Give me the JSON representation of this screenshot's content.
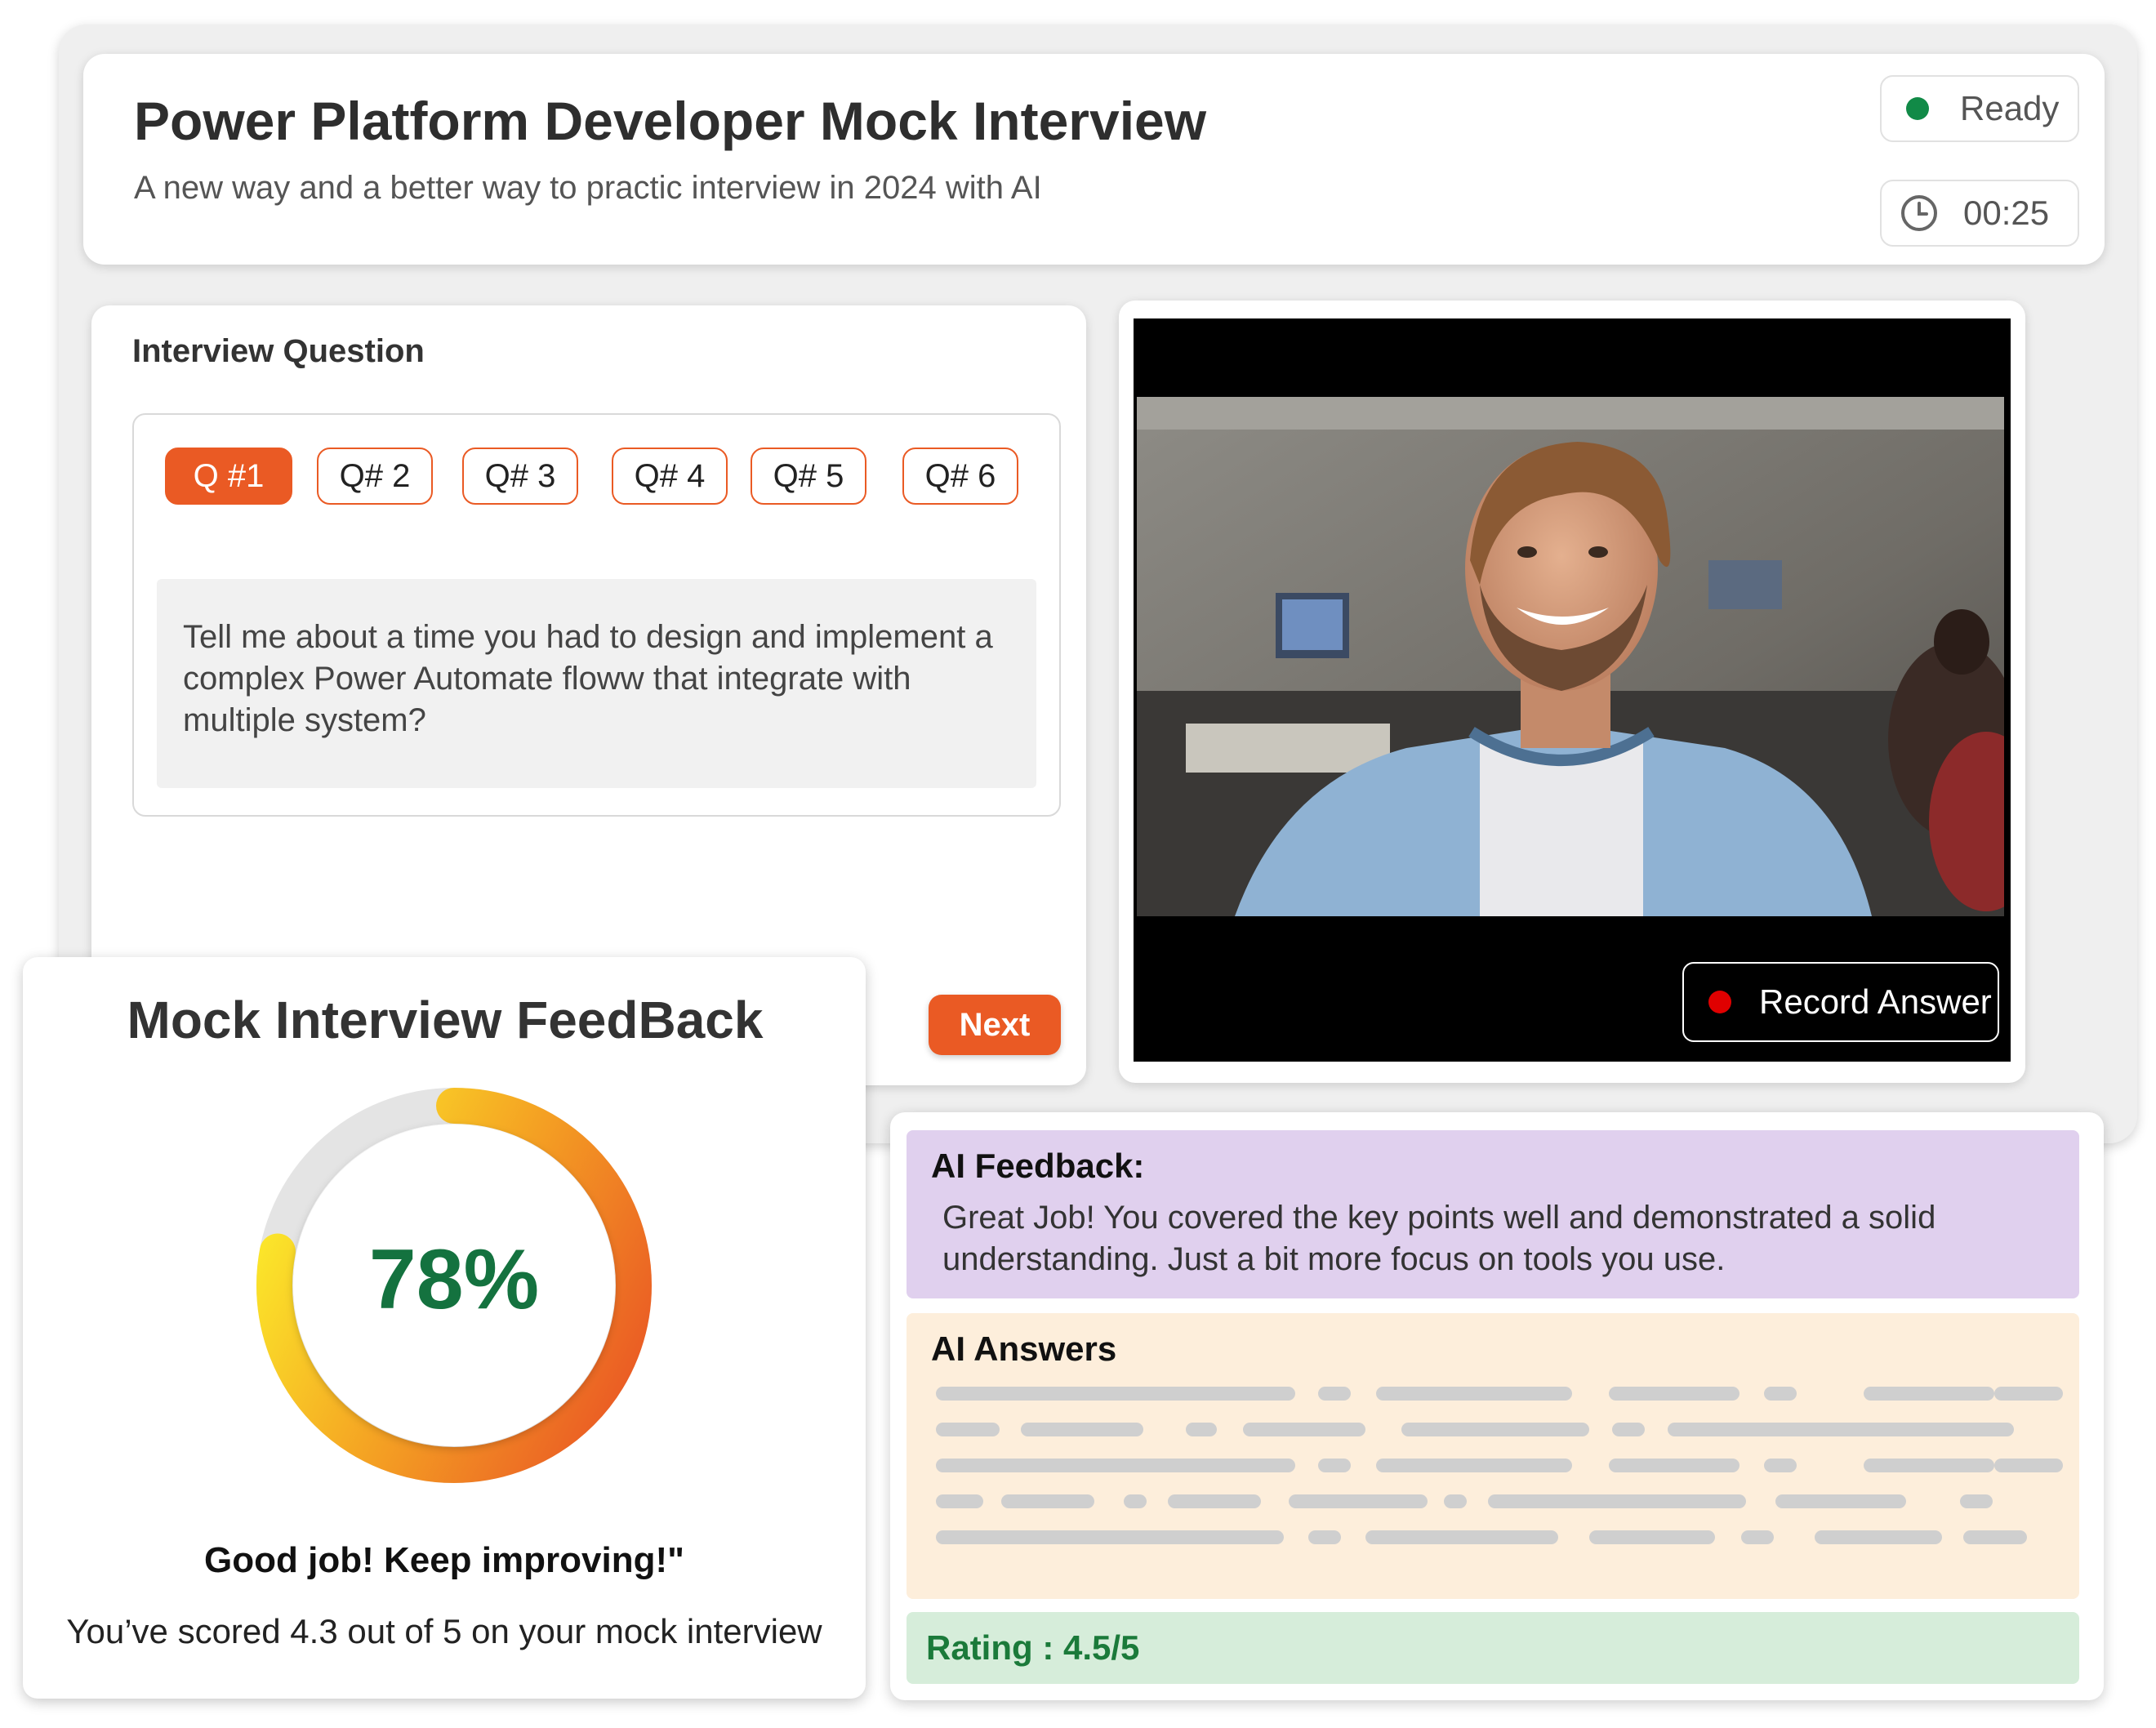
{
  "header": {
    "title": "Power Platform Developer Mock Interview",
    "subtitle": "A new way and a better way to practic interview in 2024 with AI",
    "status_label": "Ready",
    "status_color": "#118a47",
    "timer": "00:25"
  },
  "question_panel": {
    "title": "Interview Question",
    "tabs": [
      "Q #1",
      "Q# 2",
      "Q# 3",
      "Q# 4",
      "Q# 5",
      "Q# 6"
    ],
    "active_tab": 0,
    "question_text": "Tell me about a time you had to design and implement a complex Power Automate floww that integrate with multiple system?",
    "next_label": "Next",
    "accent_color": "#ea5a24"
  },
  "video": {
    "record_label": "Record Answer"
  },
  "feedback": {
    "title": "Mock Interview FeedBack",
    "score_percent": 78,
    "score_label": "78%",
    "message": "Good job! Keep improving!\"",
    "summary": "You’ve scored 4.3 out of 5 on your mock interview"
  },
  "ai": {
    "feedback_title": "AI Feedback:",
    "feedback_text": "Great Job! You covered the key points well and demonstrated a solid understanding. Just a bit more focus on tools you use.",
    "answers_title": "AI Answers",
    "rating": "Rating : 4.5/5"
  }
}
